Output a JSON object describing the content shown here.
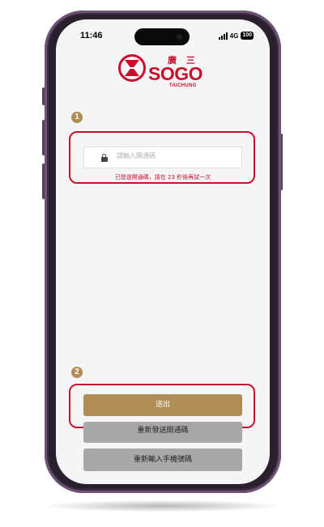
{
  "status_bar": {
    "time": "11:46",
    "network": "4G",
    "battery": "100"
  },
  "logo": {
    "chinese": "廣 三",
    "wordmark": "SOGO",
    "subtitle": "TAICHUNG"
  },
  "steps": {
    "step1": "1",
    "step2": "2"
  },
  "verification": {
    "placeholder": "請輸入開通碼",
    "value": "",
    "sent_message": "已發送開通碼，請在 23 秒後再試一次"
  },
  "actions": {
    "submit_label": "送出",
    "resend_label": "重新發送開通碼",
    "reinput_phone_label": "重新輸入手機號碼"
  },
  "colors": {
    "brand_red": "#c8102e",
    "gold": "#b08d57",
    "gray_button": "#a8a8a8"
  }
}
